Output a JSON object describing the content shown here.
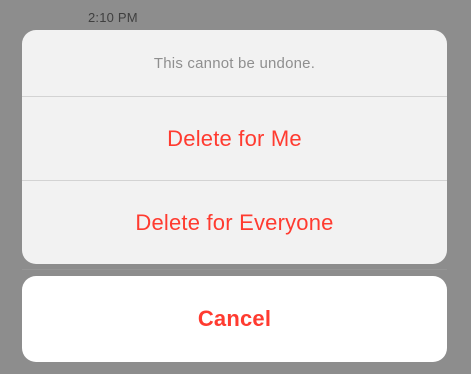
{
  "background": {
    "timestamp": "2:10 PM"
  },
  "sheet": {
    "message": "This cannot be undone.",
    "actions": [
      {
        "label": "Delete for Me"
      },
      {
        "label": "Delete for Everyone"
      }
    ]
  },
  "cancel": {
    "label": "Cancel"
  },
  "colors": {
    "destructive": "#ff3b30",
    "sheet_background": "#f2f2f2",
    "cancel_background": "#ffffff",
    "message_text": "#8f8f8f",
    "overlay": "#8d8d8d"
  }
}
